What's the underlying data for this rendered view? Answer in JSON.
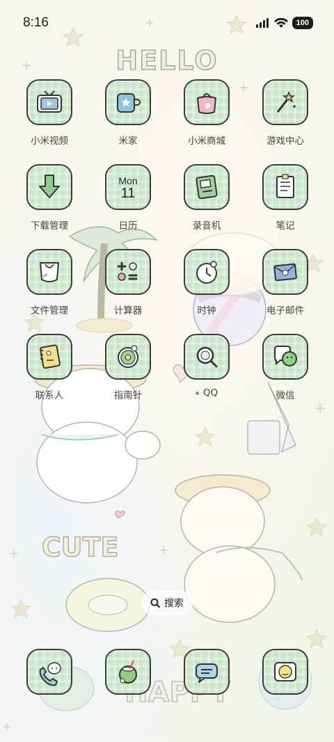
{
  "status_bar": {
    "time": "8:16",
    "battery": "100",
    "icons": [
      "signal-icon",
      "wifi-icon",
      "battery-icon"
    ]
  },
  "wallpaper": {
    "hello_text": "HELLO",
    "cute_text": "CUTE",
    "happy_text": "HAPPY"
  },
  "apps": [
    {
      "label": "小米视频",
      "icon": "tv-icon"
    },
    {
      "label": "米家",
      "icon": "mijia-icon"
    },
    {
      "label": "小米商城",
      "icon": "shopping-bag-icon"
    },
    {
      "label": "游戏中心",
      "icon": "magic-wand-icon"
    },
    {
      "label": "下载管理",
      "icon": "download-arrow-icon"
    },
    {
      "label": "日历",
      "icon": "calendar-icon",
      "month": "Mon",
      "day": "11"
    },
    {
      "label": "录音机",
      "icon": "recorder-icon"
    },
    {
      "label": "笔记",
      "icon": "notes-icon"
    },
    {
      "label": "文件管理",
      "icon": "folder-bib-icon"
    },
    {
      "label": "计算器",
      "icon": "calculator-icon"
    },
    {
      "label": "时钟",
      "icon": "clock-icon"
    },
    {
      "label": "电子邮件",
      "icon": "mail-icon"
    },
    {
      "label": "联系人",
      "icon": "contacts-book-icon"
    },
    {
      "label": "指南针",
      "icon": "compass-icon"
    },
    {
      "label": "QQ",
      "icon": "qq-icon"
    },
    {
      "label": "微信",
      "icon": "wechat-icon"
    }
  ],
  "search": {
    "label": "搜索"
  },
  "dock": [
    {
      "icon": "phone-icon"
    },
    {
      "icon": "coconut-drink-icon"
    },
    {
      "icon": "messages-icon"
    },
    {
      "icon": "egg-camera-icon"
    }
  ],
  "colors": {
    "tile": "#cfeacf",
    "tile_border": "#3a3a3a",
    "notification_dot": "#4a9be0"
  }
}
